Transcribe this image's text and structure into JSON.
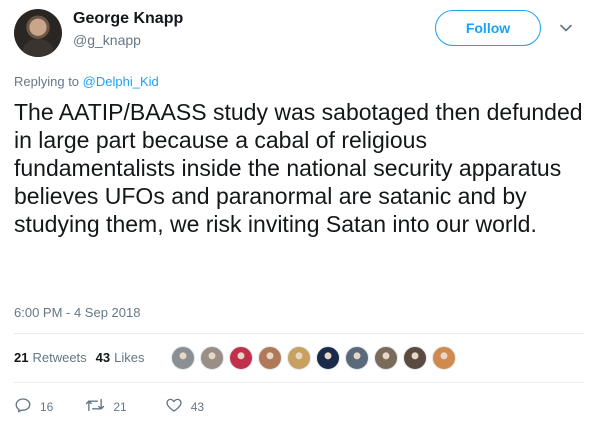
{
  "author": {
    "name": "George Knapp",
    "handle": "@g_knapp"
  },
  "follow_label": "Follow",
  "replying": {
    "prefix": "Replying to ",
    "mention": "@Delphi_Kid"
  },
  "tweet_text": "The AATIP/BAASS study was sabotaged then defunded in large part because a cabal of religious fundamentalists inside the national security apparatus believes UFOs and paranormal are satanic and by studying them, we risk inviting Satan into our world.",
  "timestamp": "6:00 PM - 4 Sep 2018",
  "stats": {
    "retweets_count": "21",
    "retweets_label": "Retweets",
    "likes_count": "43",
    "likes_label": "Likes"
  },
  "likers_colors": [
    "#8a8f94",
    "#9a8f86",
    "#c0304a",
    "#b07a5a",
    "#c8a060",
    "#1a2a4a",
    "#5a6a7a",
    "#7a6a5a",
    "#5b4a40",
    "#d08a50"
  ],
  "actions": {
    "reply_count": "16",
    "retweet_count": "21",
    "like_count": "43"
  },
  "colors": {
    "accent": "#1da1f2",
    "text": "#14171a",
    "muted": "#657786"
  }
}
